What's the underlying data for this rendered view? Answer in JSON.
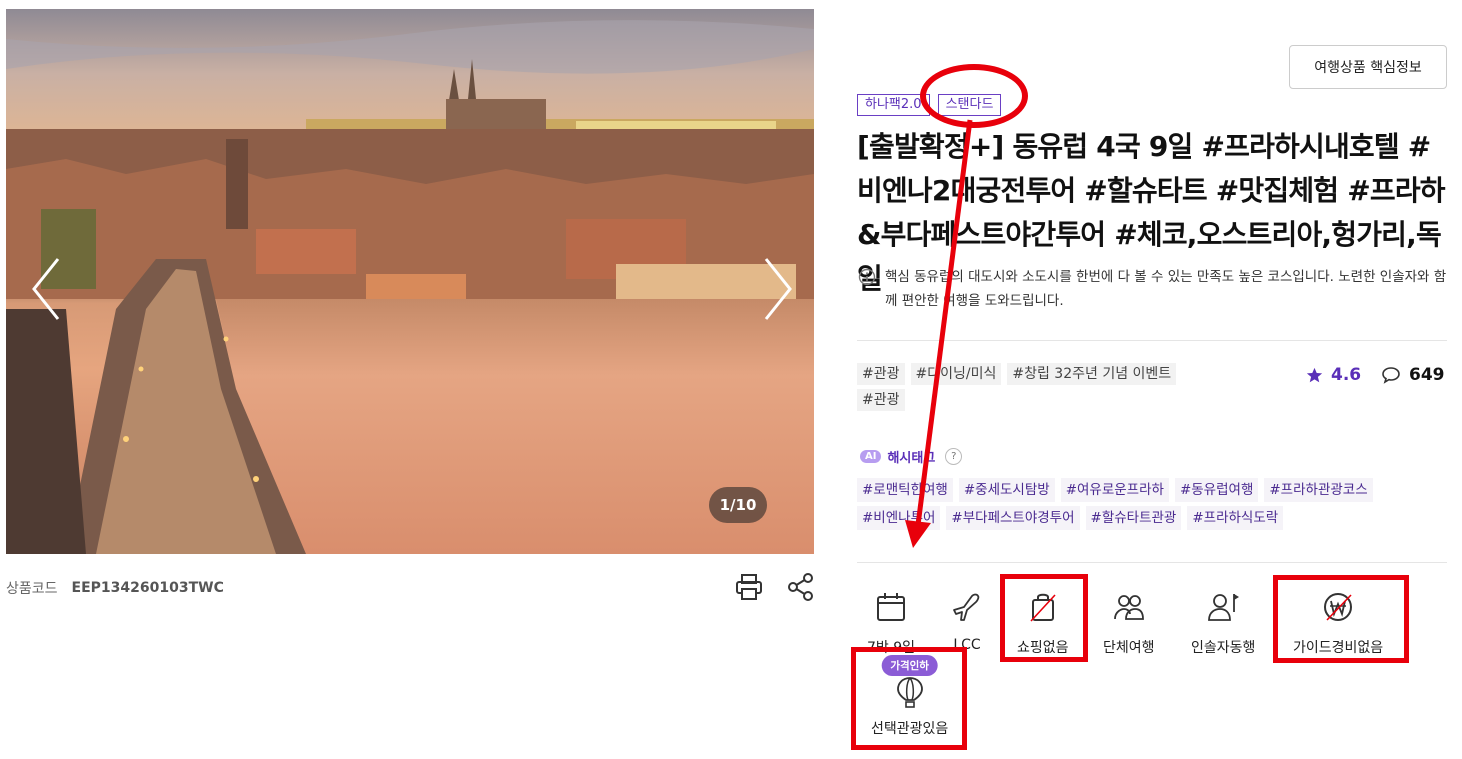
{
  "gallery": {
    "counter": "1/10",
    "prev_icon": "chevron-left-icon",
    "next_icon": "chevron-right-icon"
  },
  "product_code": {
    "label": "상품코드",
    "value": "EEP134260103TWC"
  },
  "tools": {
    "print_icon": "print-icon",
    "share_icon": "share-icon"
  },
  "key_info_button": "여행상품 핵심정보",
  "badges": [
    "하나팩2.0",
    "스탠다드"
  ],
  "title": "[출발확정+] 동유럽 4국 9일 #프라하시내호텔 #비엔나2대궁전투어 #할슈타트 #맛집체험 #프라하&부다페스트야간투어 #체코,오스트리아,헝가리,독일",
  "description": "핵심 동유럽의 대도시와 소도시를 한번에 다 볼 수 있는 만족도 높은 코스입니다. 노련한 인솔자와 함께 편안한 여행을 도와드립니다.",
  "tags": [
    "#관광",
    "#다이닝/미식",
    "#창립 32주년 기념 이벤트",
    "#관광"
  ],
  "rating": {
    "score": "4.6",
    "reviews": "649"
  },
  "ai": {
    "pill": "AI",
    "label": "해시태그",
    "help": "?"
  },
  "hashtags": [
    "#로맨틱한여행",
    "#중세도시탐방",
    "#여유로운프라하",
    "#동유럽여행",
    "#프라하관광코스",
    "#비엔나투어",
    "#부다페스트야경투어",
    "#할슈타트관광",
    "#프라하식도락"
  ],
  "features": [
    {
      "label": "7박 9일",
      "icon": "calendar-icon"
    },
    {
      "label": "LCC",
      "icon": "airplane-icon"
    },
    {
      "label": "쇼핑없음",
      "icon": "no-shopping-bag-icon"
    },
    {
      "label": "단체여행",
      "icon": "group-icon"
    },
    {
      "label": "인솔자동행",
      "icon": "guide-flag-icon"
    },
    {
      "label": "가이드경비없음",
      "icon": "no-won-icon"
    },
    {
      "label": "선택관광있음",
      "icon": "hot-air-balloon-icon",
      "badge": "가격인하"
    }
  ],
  "colors": {
    "accent": "#5a2fb8",
    "annotation": "#e8000b"
  }
}
